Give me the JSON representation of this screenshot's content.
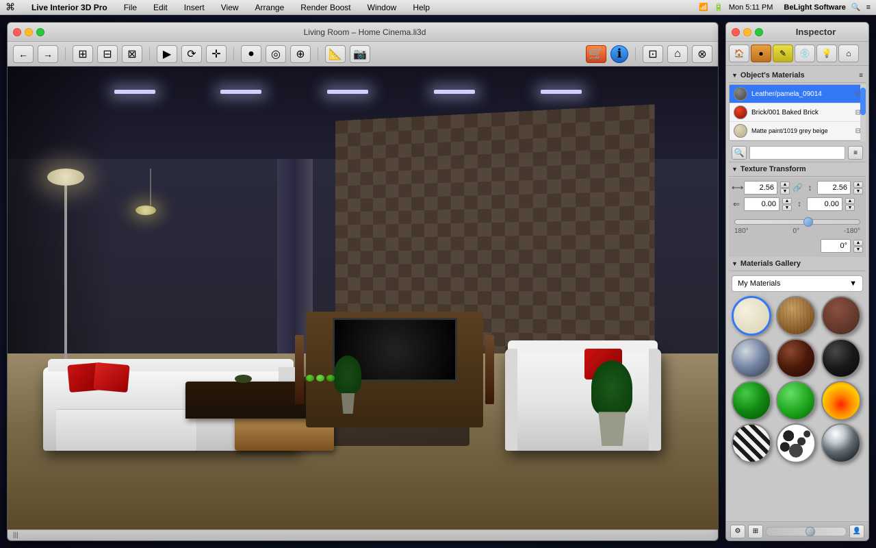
{
  "menubar": {
    "apple": "⌘",
    "items": [
      {
        "label": "Live Interior 3D Pro"
      },
      {
        "label": "File"
      },
      {
        "label": "Edit"
      },
      {
        "label": "Insert"
      },
      {
        "label": "View"
      },
      {
        "label": "Arrange"
      },
      {
        "label": "Render Boost"
      },
      {
        "label": "Window"
      },
      {
        "label": "Help"
      }
    ],
    "right": {
      "time": "Mon 5:11 PM",
      "brand": "BeLight Software"
    }
  },
  "viewport": {
    "title": "Living Room – Home Cinema.li3d",
    "status_text": "|||"
  },
  "inspector": {
    "title": "Inspector",
    "tabs": [
      {
        "icon": "🏠",
        "label": "house"
      },
      {
        "icon": "●",
        "label": "material"
      },
      {
        "icon": "✏️",
        "label": "edit"
      },
      {
        "icon": "💿",
        "label": "library"
      },
      {
        "icon": "💡",
        "label": "light"
      },
      {
        "icon": "🏠",
        "label": "room"
      }
    ],
    "materials_section": {
      "title": "Object's Materials",
      "items": [
        {
          "name": "Leather/pamela_09014",
          "color": "#6a6a6a"
        },
        {
          "name": "Brick/001 Baked Brick",
          "color": "#cc3311"
        },
        {
          "name": "Matte paint/1019 grey beige",
          "color": "#d4c8a8"
        }
      ]
    },
    "texture_transform": {
      "title": "Texture Transform",
      "scale_x": "2.56",
      "scale_y": "2.56",
      "offset_x": "0.00",
      "offset_y": "0.00",
      "angle": "0°",
      "angle_min": "180°",
      "angle_mid": "0°",
      "angle_max": "-180°"
    },
    "gallery": {
      "title": "Materials Gallery",
      "dropdown_value": "My Materials",
      "items": [
        {
          "type": "cream",
          "label": "cream"
        },
        {
          "type": "wood",
          "label": "wood"
        },
        {
          "type": "brick",
          "label": "brick"
        },
        {
          "type": "silver",
          "label": "silver"
        },
        {
          "type": "mahogany",
          "label": "mahogany"
        },
        {
          "type": "black",
          "label": "black"
        },
        {
          "type": "green1",
          "label": "green1"
        },
        {
          "type": "green2",
          "label": "green2"
        },
        {
          "type": "fire",
          "label": "fire"
        },
        {
          "type": "zebra",
          "label": "zebra"
        },
        {
          "type": "dalmatian",
          "label": "dalmatian"
        },
        {
          "type": "chrome",
          "label": "chrome"
        }
      ]
    }
  },
  "toolbar": {
    "nav_back": "←",
    "nav_fwd": "→",
    "floor_plan": "⊞",
    "elevation": "⊟",
    "threed": "⊠",
    "arrow": "▶",
    "rotate": "⟳",
    "pan": "✛",
    "sphere": "●",
    "ring": "◎",
    "camera": "⊕",
    "measure": "📐",
    "camera2": "📷",
    "view_2d": "⊡",
    "view_house": "⌂",
    "view_3d": "⊗"
  }
}
